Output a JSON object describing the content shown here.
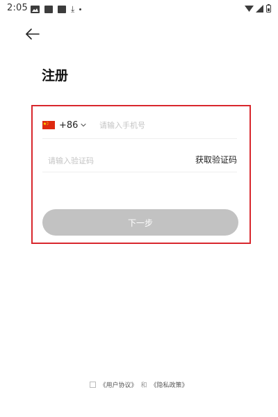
{
  "status_bar": {
    "time": "2:05",
    "left_icons": [
      "image-icon",
      "square-icon",
      "square-icon",
      "download-icon",
      "dot-icon"
    ],
    "right_icons": [
      "wifi-icon",
      "signal-icon",
      "battery-icon"
    ]
  },
  "header": {
    "back_icon": "arrow-left-icon",
    "title": "注册"
  },
  "form": {
    "country_flag": "china-flag-icon",
    "country_code": "+86",
    "phone_placeholder": "请输入手机号",
    "phone_value": "",
    "code_placeholder": "请输入验证码",
    "code_value": "",
    "get_code_label": "获取验证码",
    "next_label": "下一步"
  },
  "agreement": {
    "checked": false,
    "user_agreement": "《用户协议》",
    "conjunction": "和",
    "privacy_policy": "《隐私政策》"
  },
  "colors": {
    "highlight_border": "#d8262c",
    "button_disabled": "#c2c2c2",
    "flag_red": "#de2910",
    "flag_yellow": "#ffde00",
    "placeholder": "#c4c4c4"
  }
}
